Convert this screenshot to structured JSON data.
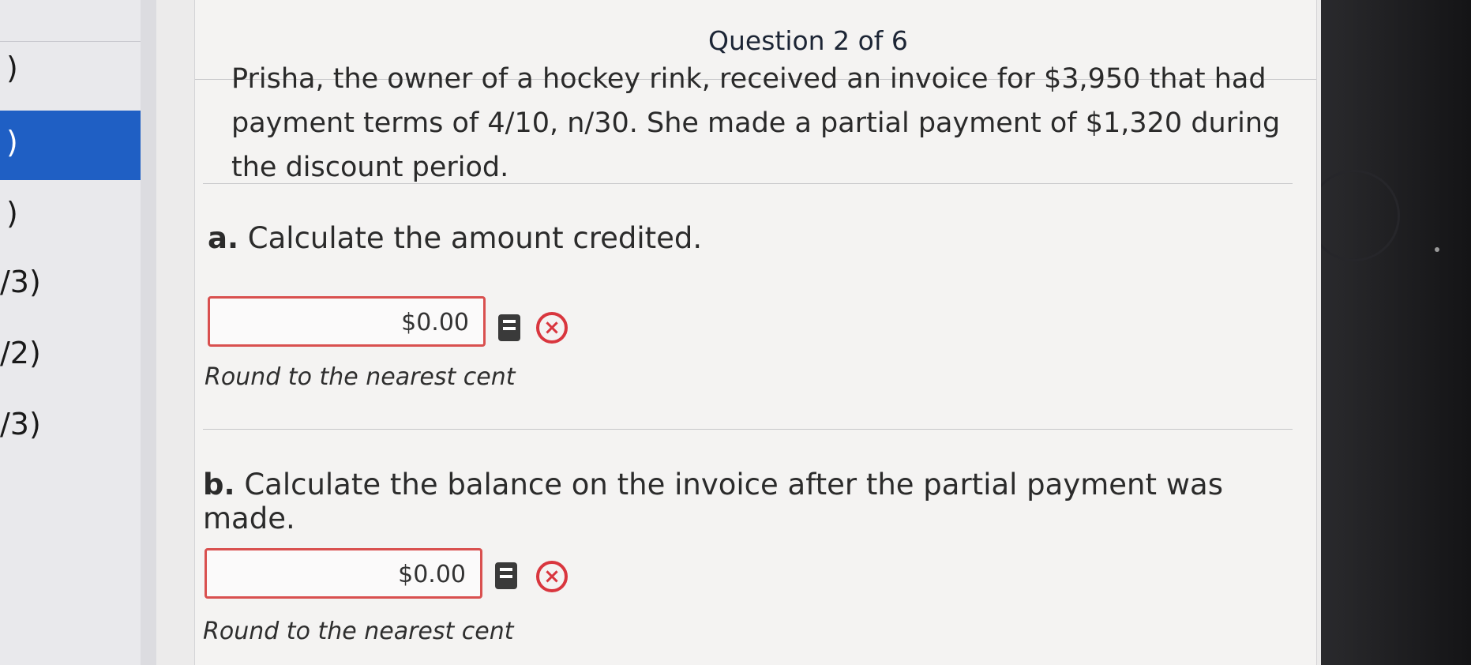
{
  "sidebar": {
    "items": [
      {
        "label": ")"
      },
      {
        "label": ")"
      },
      {
        "label": ")"
      },
      {
        "label": "/3)"
      },
      {
        "label": "/2)"
      },
      {
        "label": "/3)"
      }
    ]
  },
  "question": {
    "header": "Question 2 of 6",
    "text": "Prisha, the owner of a hockey rink, received an invoice for $3,950 that had payment terms of 4/10, n/30. She made a partial payment of $1,320 during the discount period."
  },
  "parts": [
    {
      "letter": "a.",
      "prompt": "Calculate the amount credited.",
      "value": "$0.00",
      "hint": "Round to the nearest cent"
    },
    {
      "letter": "b.",
      "prompt": "Calculate the balance on the invoice after the partial payment was made.",
      "value": "$0.00",
      "hint": "Round to the nearest cent"
    }
  ],
  "icons": {
    "calculator": "calculator-icon",
    "error": "error-x-icon"
  },
  "colors": {
    "active_nav": "#1f5fc4",
    "error": "#d9363e"
  }
}
